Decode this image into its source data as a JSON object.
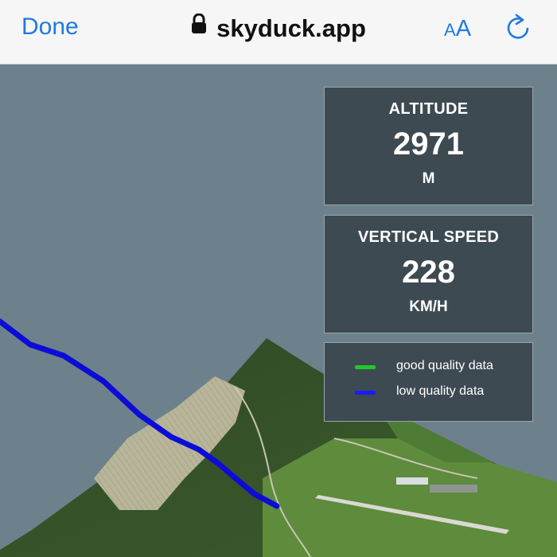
{
  "browser": {
    "done_label": "Done",
    "url": "skyduck.app",
    "text_size_label_small": "A",
    "text_size_label_big": "A",
    "lock_icon": "lock-icon",
    "reload_icon": "reload-icon",
    "accent_color": "#1f7ae0"
  },
  "altitude": {
    "label": "ALTITUDE",
    "value": "2971",
    "unit": "M"
  },
  "vertical_speed": {
    "label": "VERTICAL SPEED",
    "value": "228",
    "unit": "KM/H"
  },
  "legend": {
    "items": [
      {
        "label": "good quality data",
        "color": "#22c72b"
      },
      {
        "label": "low quality data",
        "color": "#1a1aff"
      }
    ]
  },
  "track": {
    "color": "#0c0cd6"
  },
  "colors": {
    "sky": "#6c818b",
    "panel_bg": "#3d4a52"
  }
}
